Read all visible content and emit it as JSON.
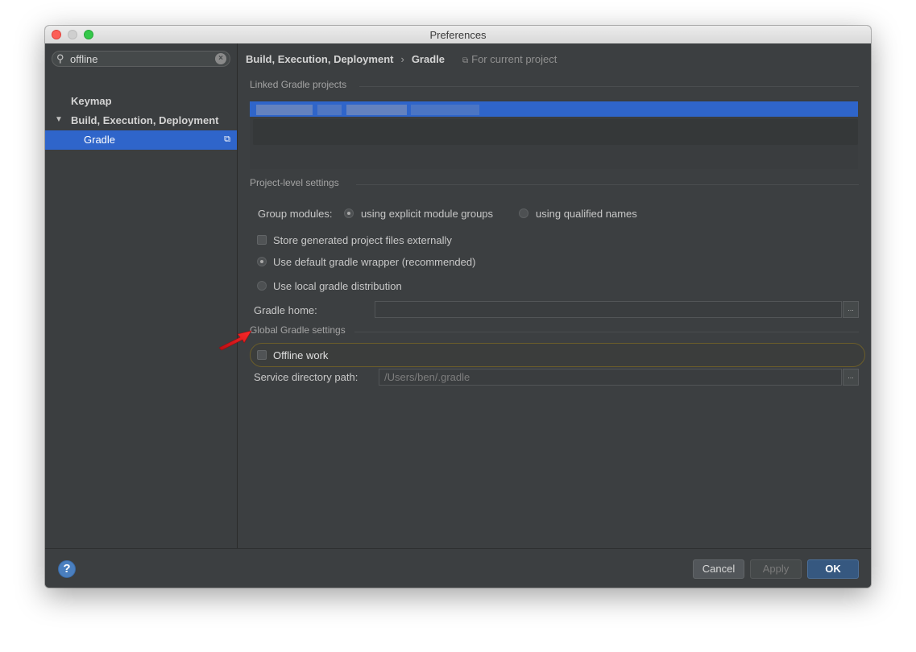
{
  "window": {
    "title": "Preferences"
  },
  "sidebar": {
    "search": {
      "value": "offline",
      "placeholder": ""
    },
    "items": [
      {
        "label": "Keymap",
        "selected": false
      },
      {
        "label": "Build, Execution, Deployment",
        "expanded": true,
        "selected": false
      },
      {
        "label": "Gradle",
        "selected": true
      }
    ]
  },
  "breadcrumb": {
    "parent": "Build, Execution, Deployment",
    "separator": "›",
    "current": "Gradle",
    "scope": "For current project"
  },
  "sections": {
    "linked": "Linked Gradle projects",
    "project": "Project-level settings",
    "global": "Global Gradle settings"
  },
  "group_modules": {
    "label": "Group modules:",
    "options": [
      "using explicit module groups",
      "using qualified names"
    ],
    "selected": "using explicit module groups"
  },
  "store_external": {
    "label": "Store generated project files externally",
    "checked": false
  },
  "distribution": {
    "options": [
      "Use default gradle wrapper (recommended)",
      "Use local gradle distribution"
    ],
    "selected": "Use default gradle wrapper (recommended)"
  },
  "gradle_home": {
    "label": "Gradle home:",
    "value": "",
    "browse": "..."
  },
  "offline_work": {
    "label": "Offline work",
    "checked": false
  },
  "service_dir": {
    "label": "Service directory path:",
    "value": "/Users/ben/.gradle",
    "browse": "..."
  },
  "footer": {
    "help": "?",
    "cancel": "Cancel",
    "apply": "Apply",
    "ok": "OK"
  },
  "colors": {
    "selection": "#2f65ca",
    "accent_arrow": "#e8141c",
    "ok_button": "#365880"
  }
}
